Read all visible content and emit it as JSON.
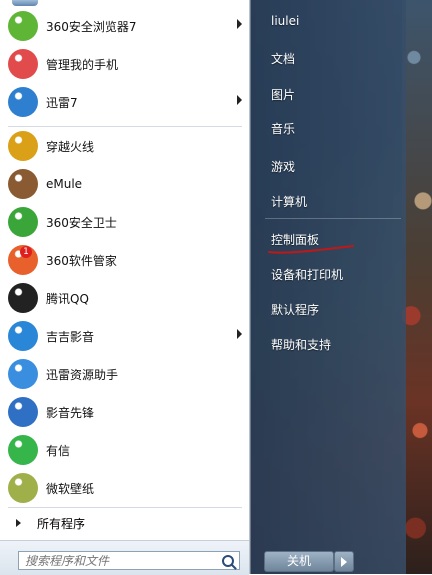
{
  "left_pane": {
    "programs": [
      {
        "label": "360安全浏览器7",
        "icon": "browser-360-icon",
        "color": "#5fb536",
        "arrow": true
      },
      {
        "label": "管理我的手机",
        "icon": "phone-manager-icon",
        "color": "#e24b4b",
        "arrow": false
      },
      {
        "label": "迅雷7",
        "icon": "xunlei-icon",
        "color": "#2f7fd0",
        "arrow": true
      },
      {
        "label": "穿越火线",
        "icon": "crossfire-icon",
        "color": "#d9a018",
        "arrow": false
      },
      {
        "label": "eMule",
        "icon": "emule-icon",
        "color": "#8a5a32",
        "arrow": false
      },
      {
        "label": "360安全卫士",
        "icon": "security-360-icon",
        "color": "#3aa639",
        "arrow": false
      },
      {
        "label": "360软件管家",
        "icon": "software-manager-icon",
        "color": "#e8612c",
        "arrow": false
      },
      {
        "label": "腾讯QQ",
        "icon": "qq-penguin-icon",
        "color": "#222222",
        "arrow": false
      },
      {
        "label": "吉吉影音",
        "icon": "jiji-player-icon",
        "color": "#2a86d6",
        "arrow": true
      },
      {
        "label": "迅雷资源助手",
        "icon": "magnifier-icon",
        "color": "#3a8ee0",
        "arrow": false
      },
      {
        "label": "影音先锋",
        "icon": "xfplay-icon",
        "color": "#2f6fc4",
        "arrow": false
      },
      {
        "label": "有信",
        "icon": "youxin-icon",
        "color": "#35b54a",
        "arrow": false
      },
      {
        "label": "微软壁纸",
        "icon": "wallpaper-icon",
        "color": "#9fb04a",
        "arrow": false
      }
    ],
    "all_programs_label": "所有程序",
    "search_placeholder": "搜索程序和文件",
    "badge_360_software": "1"
  },
  "right_pane": {
    "items": [
      {
        "label": "liulei",
        "name": "user-name"
      },
      {
        "label": "文档",
        "name": "documents"
      },
      {
        "label": "图片",
        "name": "pictures"
      },
      {
        "label": "音乐",
        "name": "music"
      },
      {
        "label": "游戏",
        "name": "games"
      },
      {
        "label": "计算机",
        "name": "computer"
      },
      {
        "label": "控制面板",
        "name": "control-panel"
      },
      {
        "label": "设备和打印机",
        "name": "devices-printers"
      },
      {
        "label": "默认程序",
        "name": "default-programs"
      },
      {
        "label": "帮助和支持",
        "name": "help-support"
      }
    ],
    "shutdown_label": "关机",
    "highlight_color": "#c01818"
  }
}
